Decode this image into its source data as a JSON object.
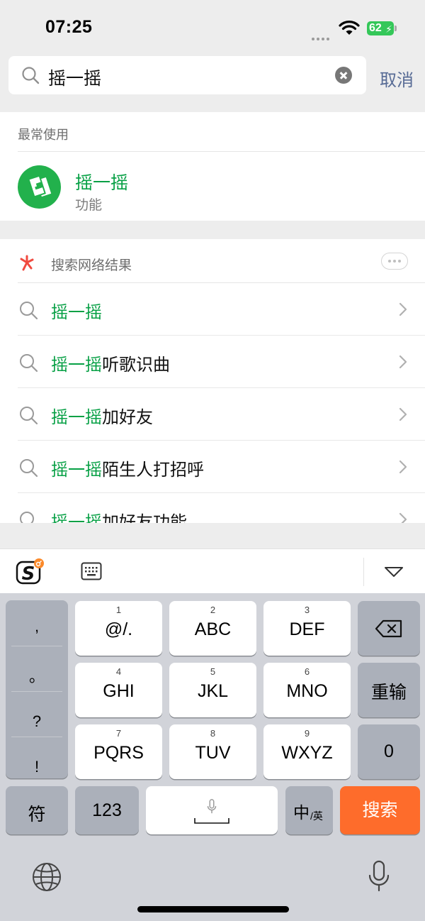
{
  "status_bar": {
    "time": "07:25",
    "battery": "62"
  },
  "search": {
    "query": "摇一摇",
    "cancel_label": "取消"
  },
  "recent": {
    "title": "最常使用",
    "item": {
      "title": "摇一摇",
      "subtitle": "功能"
    }
  },
  "web": {
    "title": "搜索网络结果",
    "results": [
      {
        "highlight": "摇一摇",
        "rest": ""
      },
      {
        "highlight": "摇一摇",
        "rest": "听歌识曲"
      },
      {
        "highlight": "摇一摇",
        "rest": "加好友"
      },
      {
        "highlight": "摇一摇",
        "rest": "陌生人打招呼"
      },
      {
        "highlight": "摇一摇",
        "rest": "加好友功能"
      }
    ]
  },
  "keyboard": {
    "punct": [
      ",",
      "。",
      "?",
      "!"
    ],
    "keys": {
      "k1": {
        "num": "1",
        "label": "@/."
      },
      "k2": {
        "num": "2",
        "label": "ABC"
      },
      "k3": {
        "num": "3",
        "label": "DEF"
      },
      "k4": {
        "num": "4",
        "label": "GHI"
      },
      "k5": {
        "num": "5",
        "label": "JKL"
      },
      "k6": {
        "num": "6",
        "label": "MNO"
      },
      "k7": {
        "num": "7",
        "label": "PQRS"
      },
      "k8": {
        "num": "8",
        "label": "TUV"
      },
      "k9": {
        "num": "9",
        "label": "WXYZ"
      }
    },
    "reinput_label": "重输",
    "zero_label": "0",
    "symbols_label": "符",
    "numbers_label": "123",
    "lang_main": "中",
    "lang_sub": "/英",
    "search_label": "搜索"
  },
  "colors": {
    "accent_green": "#07a045",
    "link_blue": "#576b95",
    "search_key": "#fe6c2b"
  }
}
